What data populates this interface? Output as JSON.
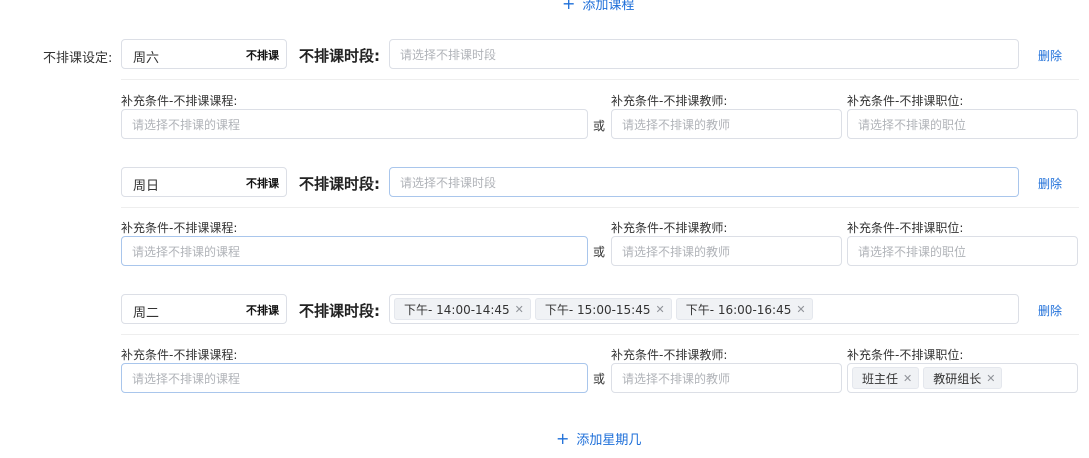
{
  "top_action": {
    "label": "添加课程"
  },
  "setting": {
    "label": "不排课设定:"
  },
  "common": {
    "period_label": "不排课时段:",
    "period_placeholder": "请选择不排课时段",
    "delete_label": "删除",
    "or_label": "或",
    "course_label": "补充条件-不排课课程:",
    "course_placeholder": "请选择不排课的课程",
    "teacher_label": "补充条件-不排课教师:",
    "teacher_placeholder": "请选择不排课的教师",
    "position_label": "补充条件-不排课职位:",
    "position_placeholder": "请选择不排课的职位",
    "day_tag": "不排课"
  },
  "rules": [
    {
      "day": "周六",
      "periods": [],
      "courses": [],
      "teachers": [],
      "positions": []
    },
    {
      "day": "周日",
      "periods": [],
      "courses": [],
      "teachers": [],
      "positions": []
    },
    {
      "day": "周二",
      "periods": [
        "下午- 14:00-14:45",
        "下午- 15:00-15:45",
        "下午- 16:00-16:45"
      ],
      "courses": [],
      "teachers": [],
      "positions": [
        "班主任",
        "教研组长"
      ]
    }
  ],
  "bottom_action": {
    "label": "添加星期几"
  },
  "colors": {
    "accent": "#1e6fd9",
    "border": "#dcdfe6",
    "placeholder": "#b0b3b8"
  }
}
